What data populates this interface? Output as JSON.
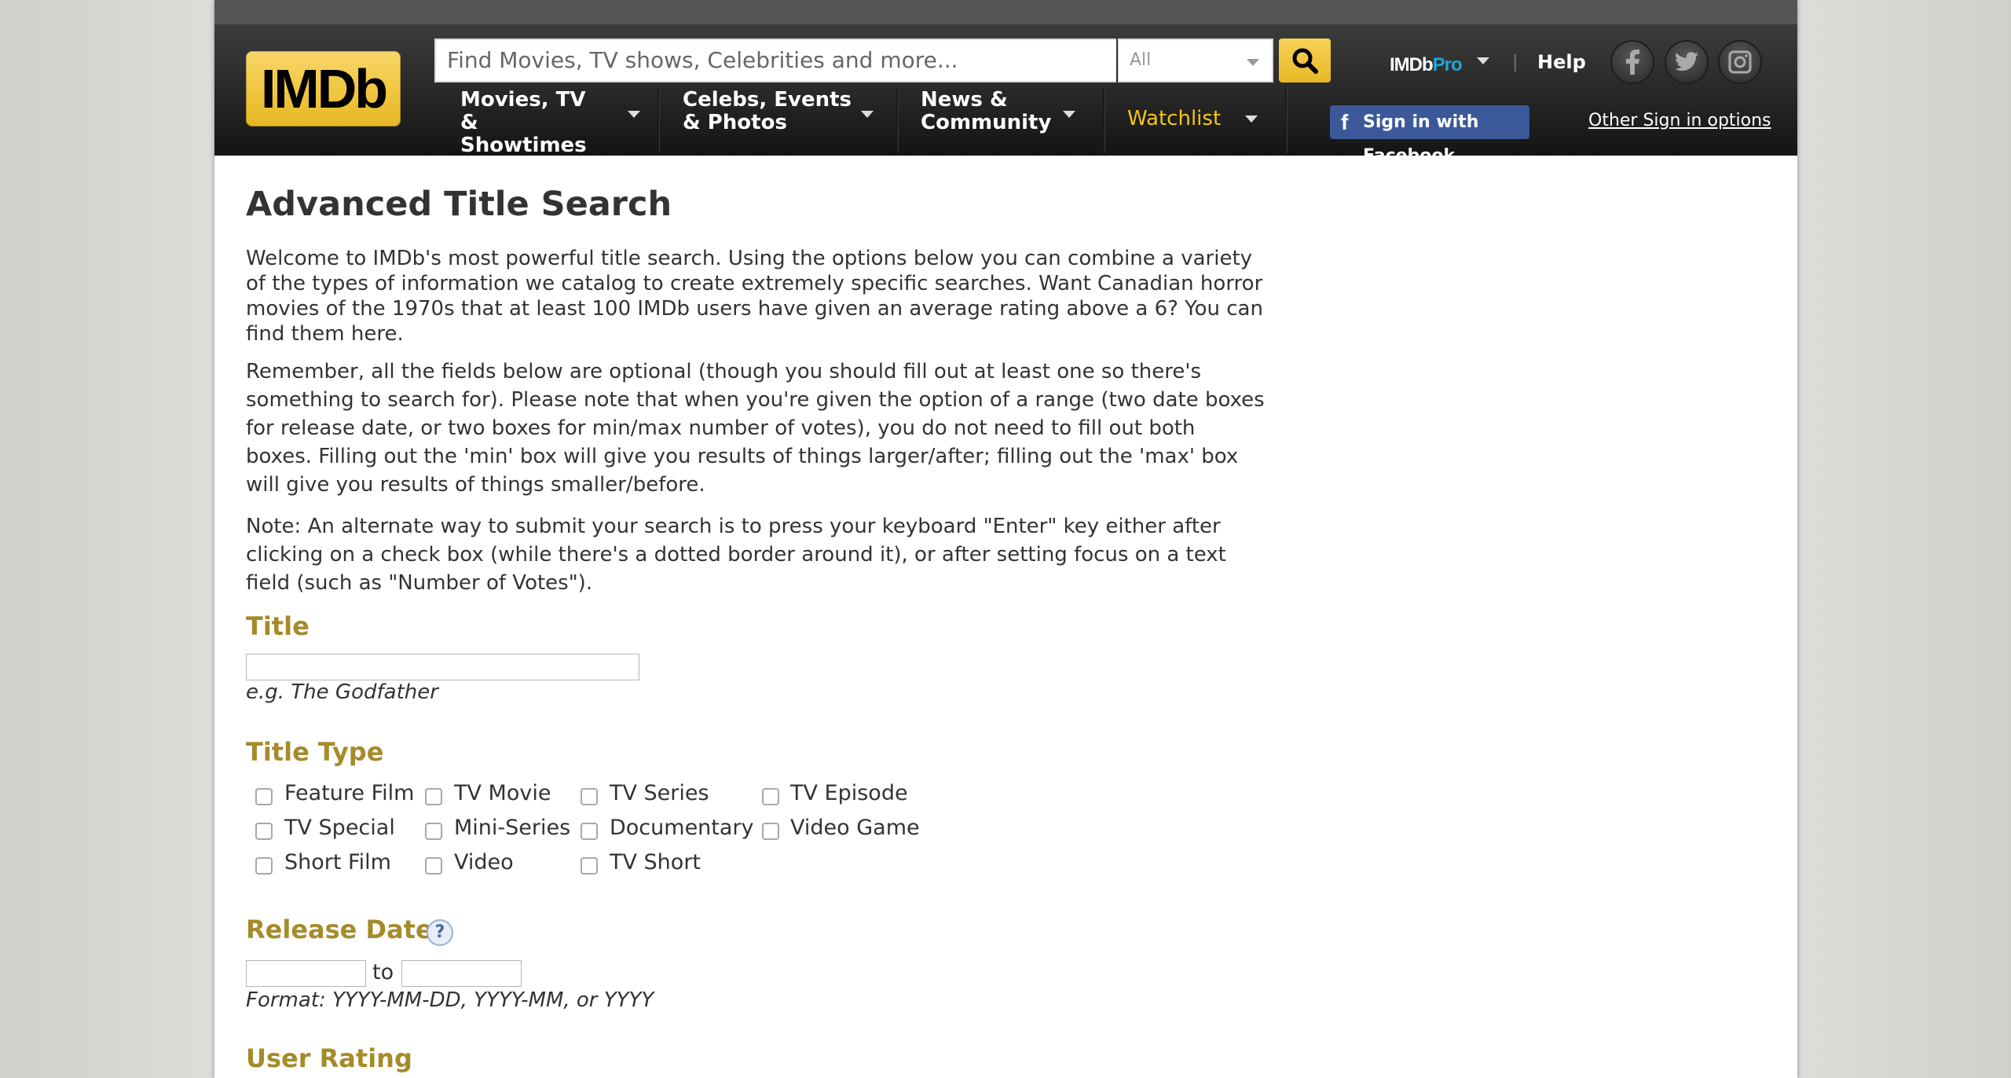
{
  "header": {
    "logo_text": "IMDb",
    "search": {
      "placeholder": "Find Movies, TV shows, Celebrities and more...",
      "category": "All"
    },
    "nav": [
      {
        "label": "Movies, TV & Showtimes"
      },
      {
        "label": "Celebs, Events & Photos"
      },
      {
        "label": "News & Community"
      },
      {
        "label": "Watchlist"
      }
    ],
    "pro_label_a": "IMDb",
    "pro_label_b": "Pro",
    "separator": "|",
    "help": "Help",
    "social": [
      "facebook-icon",
      "twitter-icon",
      "instagram-icon"
    ],
    "facebook_signin": "Sign in with Facebook",
    "other_signin": "Other Sign in options",
    "accent_color": "#f5c518"
  },
  "main": {
    "title": "Advanced Title Search",
    "intro": "Welcome to IMDb's most powerful title search. Using the options below you can combine a variety of the types of information we catalog to create extremely specific searches. Want Canadian horror movies of the 1970s that at least 100 IMDb users have given an average rating above a 6? You can find them here.",
    "remember": "Remember, all the fields below are optional (though you should fill out at least one so there's something to search for). Please note that when you're given the option of a range (two date boxes for release date, or two boxes for min/max number of votes), you do not need to fill out both boxes. Filling out the 'min' box will give you results of things larger/after; filling out the 'max' box will give you results of things smaller/before.",
    "note": "Note: An alternate way to submit your search is to press your keyboard \"Enter\" key either after clicking on a check box (while there's a dotted border around it), or after setting focus on a text field (such as \"Number of Votes\").",
    "title_section": {
      "heading": "Title",
      "value": "",
      "hint_prefix": "e.g. ",
      "hint_example": "The Godfather"
    },
    "title_type": {
      "heading": "Title Type",
      "options": [
        "Feature Film",
        "TV Movie",
        "TV Series",
        "TV Episode",
        "TV Special",
        "Mini-Series",
        "Documentary",
        "Video Game",
        "Short Film",
        "Video",
        "TV Short"
      ]
    },
    "release_date": {
      "heading": "Release Date",
      "help": "?",
      "from": "",
      "to_label": "to",
      "to": "",
      "format_hint": "Format: YYYY-MM-DD, YYYY-MM, or YYYY"
    },
    "user_rating": {
      "heading": "User Rating"
    }
  }
}
